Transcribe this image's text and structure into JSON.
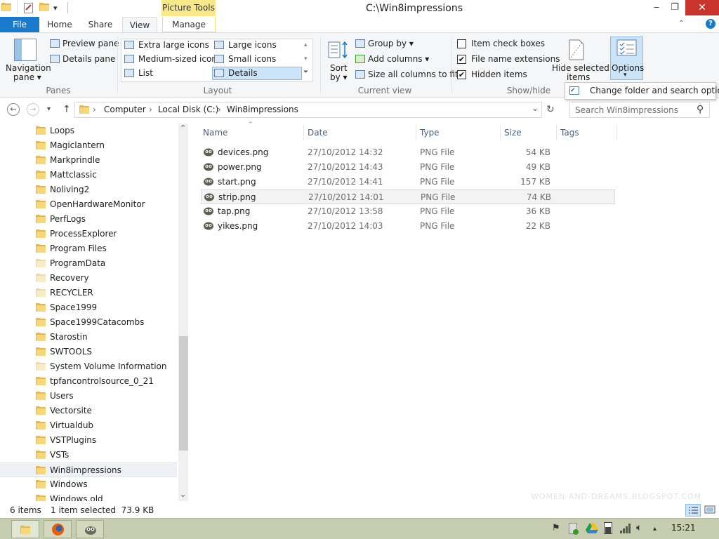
{
  "window": {
    "title": "C:\\Win8impressions",
    "contextual_tab": "Picture Tools",
    "minimize": "‒",
    "maximize": "❐",
    "close": "✕"
  },
  "ribbon_tabs": {
    "file": "File",
    "home": "Home",
    "share": "Share",
    "view": "View",
    "manage": "Manage"
  },
  "ribbon": {
    "panes": {
      "label": "Panes",
      "navigation_pane": "Navigation",
      "navigation_pane_2": "pane ▾",
      "preview_pane": "Preview pane",
      "details_pane": "Details pane"
    },
    "layout": {
      "label": "Layout",
      "extra_large": "Extra large icons",
      "large": "Large icons",
      "medium": "Medium-sized icons",
      "small": "Small icons",
      "list": "List",
      "details": "Details"
    },
    "current_view": {
      "label": "Current view",
      "sort_by": "Sort",
      "sort_by_2": "by ▾",
      "group_by": "Group by ▾",
      "add_columns": "Add columns ▾",
      "size_all_columns": "Size all columns to fit"
    },
    "show_hide": {
      "label": "Show/hide",
      "item_check_boxes": "Item check boxes",
      "file_name_extensions": "File name extensions",
      "hidden_items": "Hidden items",
      "hide_selected": "Hide selected",
      "hide_selected_2": "items",
      "check_mark": "✔"
    },
    "options": {
      "label": "Options",
      "arrow": "▾",
      "menu_item": "Change folder and search options"
    }
  },
  "address": {
    "back": "←",
    "forward": "→",
    "recent": "▾",
    "up": "↑",
    "crumbs": [
      "Computer",
      "Local Disk (C:)",
      "Win8impressions"
    ],
    "sep": "›",
    "dropdown": "⌄",
    "refresh": "↻",
    "search_placeholder": "Search Win8impressions",
    "search_icon": "⚲"
  },
  "nav_pane": {
    "items": [
      {
        "label": "Loops",
        "pale": false
      },
      {
        "label": "Magiclantern",
        "pale": false
      },
      {
        "label": "Markprindle",
        "pale": false
      },
      {
        "label": "Mattclassic",
        "pale": false
      },
      {
        "label": "Noliving2",
        "pale": false
      },
      {
        "label": "OpenHardwareMonitor",
        "pale": false
      },
      {
        "label": "PerfLogs",
        "pale": false
      },
      {
        "label": "ProcessExplorer",
        "pale": false
      },
      {
        "label": "Program Files",
        "pale": false
      },
      {
        "label": "ProgramData",
        "pale": true
      },
      {
        "label": "Recovery",
        "pale": true
      },
      {
        "label": "RECYCLER",
        "pale": true
      },
      {
        "label": "Space1999",
        "pale": false
      },
      {
        "label": "Space1999Catacombs",
        "pale": false
      },
      {
        "label": "Starostin",
        "pale": false
      },
      {
        "label": "SWTOOLS",
        "pale": false
      },
      {
        "label": "System Volume Information",
        "pale": true
      },
      {
        "label": "tpfancontrolsource_0_21",
        "pale": false
      },
      {
        "label": "Users",
        "pale": false
      },
      {
        "label": "Vectorsite",
        "pale": false
      },
      {
        "label": "Virtualdub",
        "pale": false
      },
      {
        "label": "VSTPlugins",
        "pale": false
      },
      {
        "label": "VSTs",
        "pale": false
      },
      {
        "label": "Win8impressions",
        "pale": false
      },
      {
        "label": "Windows",
        "pale": false
      },
      {
        "label": "Windows.old",
        "pale": false
      }
    ],
    "selected_index": 23,
    "scroll_up": "⌃",
    "scroll_down": "⌄"
  },
  "file_list": {
    "headers": {
      "name": "Name",
      "date": "Date",
      "type": "Type",
      "size": "Size",
      "tags": "Tags",
      "sort_indicator": "⌃"
    },
    "rows": [
      {
        "name": "devices.png",
        "date": "27/10/2012 14:32",
        "type": "PNG File",
        "size": "54 KB"
      },
      {
        "name": "power.png",
        "date": "27/10/2012 14:43",
        "type": "PNG File",
        "size": "49 KB"
      },
      {
        "name": "start.png",
        "date": "27/10/2012 14:41",
        "type": "PNG File",
        "size": "157 KB"
      },
      {
        "name": "strip.png",
        "date": "27/10/2012 14:01",
        "type": "PNG File",
        "size": "74 KB"
      },
      {
        "name": "tap.png",
        "date": "27/10/2012 13:58",
        "type": "PNG File",
        "size": "36 KB"
      },
      {
        "name": "yikes.png",
        "date": "27/10/2012 14:03",
        "type": "PNG File",
        "size": "22 KB"
      }
    ],
    "selected_index": 3
  },
  "status": {
    "item_count": "6 items",
    "selection": "1 item selected  73.9 KB",
    "watermark": "WOMEN-AND-DREAMS.BLOGSPOT.COM"
  },
  "taskbar": {
    "clock": "15:21"
  },
  "colors": {
    "accent": "#1979ca",
    "contextual": "#f7e98a",
    "close": "#c7352b",
    "taskbar": "#c7cdb1"
  }
}
